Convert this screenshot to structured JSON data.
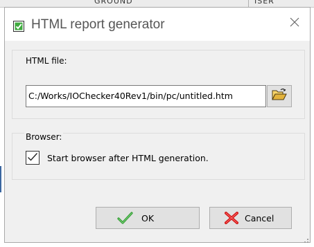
{
  "background": {
    "left_text": "GROUND",
    "right_text": "ISER"
  },
  "dialog": {
    "title": "HTML report generator",
    "title_icon": "green-checkbox-icon",
    "close_icon": "close-icon"
  },
  "html_file_group": {
    "label": "HTML file:",
    "path_value": "C:/Works/IOChecker40Rev1/bin/pc/untitled.htm",
    "browse_icon": "open-folder-icon"
  },
  "browser_group": {
    "label": "Browser:",
    "checkbox_label": "Start browser after HTML generation.",
    "checked": true
  },
  "buttons": {
    "ok_label": "OK",
    "ok_icon": "green-check-icon",
    "cancel_label": "Cancel",
    "cancel_icon": "red-x-icon"
  },
  "colors": {
    "dialog_bg": "#f0f0f0",
    "titlebar_bg": "#ffffff",
    "button_bg": "#e1e1e1",
    "ok_green": "#2e9b2e",
    "cancel_red": "#d21a1a"
  }
}
